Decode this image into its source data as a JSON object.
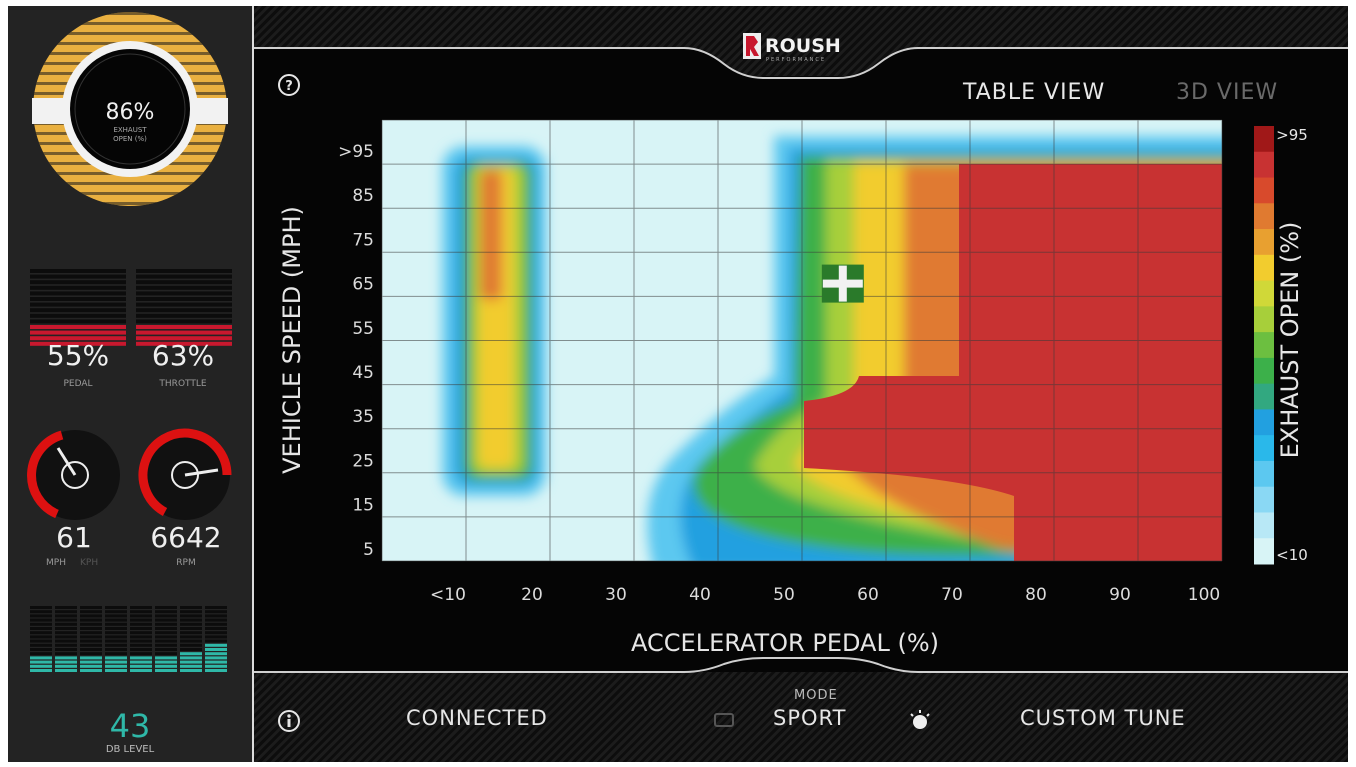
{
  "brand": {
    "name": "ROUSH",
    "sub": "PERFORMANCE"
  },
  "sidebar": {
    "exhaust_gauge": {
      "value": "86%",
      "label_line1": "EXHAUST",
      "label_line2": "OPEN (%)",
      "level": 0.86
    },
    "pedal": {
      "value": "55%",
      "label": "PEDAL",
      "level": 0.55
    },
    "throttle": {
      "value": "63%",
      "label": "THROTTLE",
      "level": 0.63
    },
    "speed": {
      "value": "61",
      "unit_active": "MPH",
      "unit_inactive": "KPH"
    },
    "rpm": {
      "value": "6642",
      "label": "RPM"
    },
    "db": {
      "value": "43",
      "label": "DB LEVEL"
    }
  },
  "views": {
    "table": "TABLE VIEW",
    "three_d": "3D VIEW",
    "active": "table"
  },
  "colors": {
    "accent_red": "#c8182e",
    "gauge_amber": "#e9b040",
    "db_teal": "#2fb8a8",
    "map_red": "#c83232"
  },
  "chart_data": {
    "type": "heatmap",
    "xlabel": "ACCELERATOR PEDAL (%)",
    "ylabel": "VEHICLE SPEED (MPH)",
    "x_ticks": [
      "<10",
      "20",
      "30",
      "40",
      "50",
      "60",
      "70",
      "80",
      "90",
      "100"
    ],
    "y_ticks": [
      ">95",
      "85",
      "75",
      "65",
      "55",
      "45",
      "35",
      "25",
      "15",
      "5"
    ],
    "colorbar": {
      "label": "EXHAUST OPEN (%)",
      "max_label": ">95",
      "min_label": "<10"
    },
    "cursor": {
      "x": 57,
      "y": 65
    }
  },
  "status": {
    "connection": "CONNECTED",
    "mode_label": "MODE",
    "mode": "SPORT",
    "tune": "CUSTOM TUNE"
  }
}
